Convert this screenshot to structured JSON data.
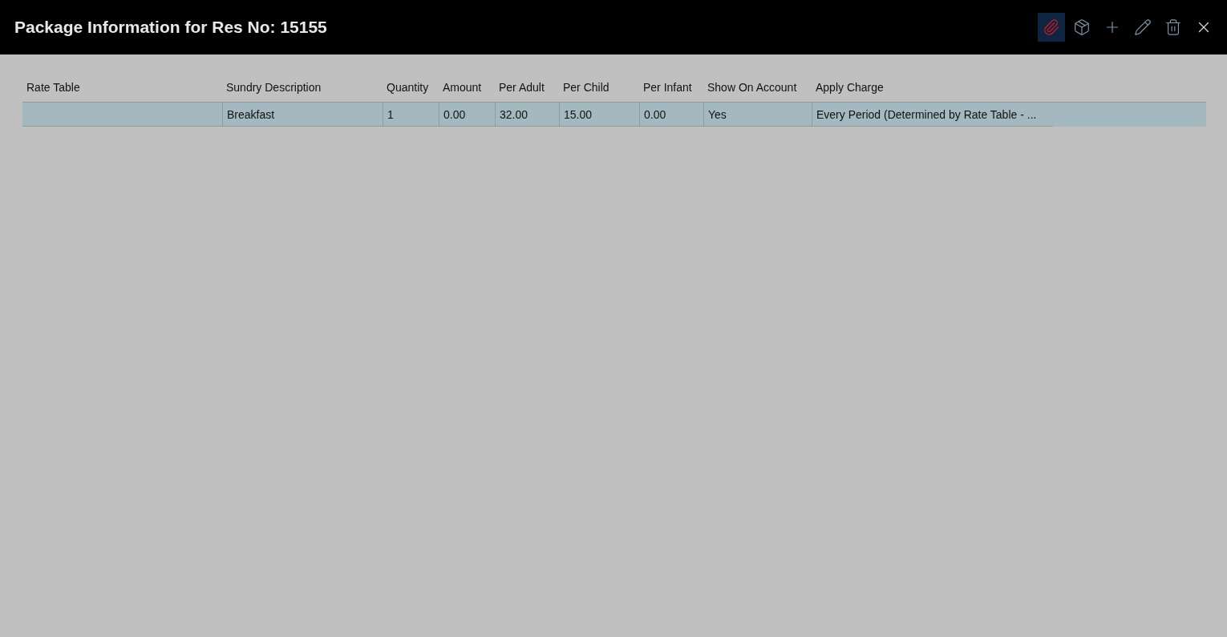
{
  "window": {
    "title": "Package Information for Res No: 15155"
  },
  "toolbar": [
    {
      "kind": "clip",
      "selected": true
    },
    {
      "kind": "package",
      "selected": false
    },
    {
      "kind": "add",
      "selected": false
    },
    {
      "kind": "edit",
      "selected": false
    },
    {
      "kind": "delete",
      "selected": false
    },
    {
      "kind": "close",
      "selected": false
    }
  ],
  "table": {
    "columns": [
      "Rate Table",
      "Sundry Description",
      "Quantity",
      "Amount",
      "Per Adult",
      "Per Child",
      "Per Infant",
      "Show On Account",
      "Apply Charge"
    ],
    "rows": [
      {
        "selected": true,
        "cells": [
          "",
          "Breakfast",
          "1",
          "0.00",
          "32.00",
          "15.00",
          "0.00",
          "Yes",
          "Every Period (Determined by Rate Table - ..."
        ]
      }
    ]
  }
}
